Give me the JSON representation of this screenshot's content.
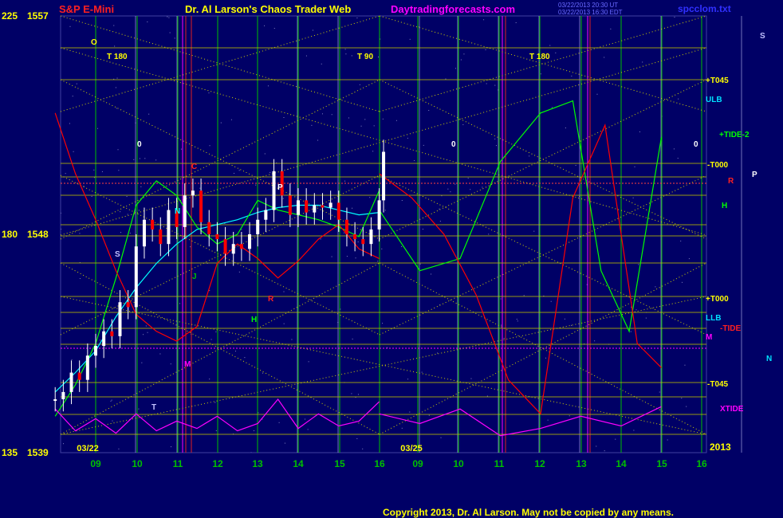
{
  "header": {
    "instrument": "S&P E-Mini",
    "title": "Dr. Al Larson's Chaos Trader Web",
    "site": "Daytradingforecasts.com",
    "timestamp_line1": "03/22/2013 20:30 UT",
    "timestamp_line2": "03/22/2013 16:30 EDT",
    "file": "spcclom.txt"
  },
  "footer": {
    "copyright": "Copyright 2013, Dr. Al Larson. May not be copied by any means.",
    "year": "2013"
  },
  "chart_data": {
    "type": "line",
    "title": "S&P E-Mini",
    "y_axis": {
      "range": [
        1539,
        1557
      ],
      "tick_labels": [
        {
          "angle": "225",
          "price": "1557"
        },
        {
          "angle": "180",
          "price": "1548"
        },
        {
          "angle": "135",
          "price": "1539"
        }
      ]
    },
    "x_axis": {
      "hour_labels": [
        "09",
        "10",
        "11",
        "12",
        "13",
        "14",
        "15",
        "16",
        "09",
        "10",
        "11",
        "12",
        "13",
        "14",
        "15",
        "16"
      ],
      "date_labels": [
        "03/22",
        "03/25"
      ]
    },
    "grid": true,
    "price_series": {
      "name": "",
      "x_hours": [
        8.0,
        8.2,
        8.4,
        8.6,
        8.8,
        9.0,
        9.2,
        9.4,
        9.6,
        9.8,
        10.0,
        10.2,
        10.4,
        10.6,
        10.8,
        11.0,
        11.2,
        11.4,
        11.6,
        11.8,
        12.0,
        12.2,
        12.4,
        12.6,
        12.8,
        13.0,
        13.2,
        13.4,
        13.6,
        13.8,
        14.0,
        14.2,
        14.4,
        14.6,
        14.8,
        15.0,
        15.2,
        15.4,
        15.6,
        15.8,
        16.0,
        16.1
      ],
      "prices": [
        1541.2,
        1541.5,
        1542.3,
        1542.0,
        1543.0,
        1543.4,
        1544.0,
        1543.8,
        1545.2,
        1545.0,
        1547.5,
        1548.6,
        1548.2,
        1547.6,
        1549.0,
        1548.3,
        1549.6,
        1549.8,
        1548.5,
        1548.0,
        1547.8,
        1547.2,
        1547.6,
        1547.4,
        1548.0,
        1548.6,
        1549.0,
        1550.6,
        1549.6,
        1548.8,
        1549.4,
        1548.9,
        1549.2,
        1549.1,
        1549.3,
        1548.6,
        1548.0,
        1547.8,
        1547.6,
        1548.2,
        1549.4,
        1551.4
      ]
    },
    "series": [
      {
        "name": "",
        "color": "#00FFFF",
        "hours": [
          8.0,
          8.5,
          9.0,
          9.5,
          10.0,
          10.5,
          11.0,
          11.5,
          12.0,
          12.5,
          13.0,
          13.5,
          14.0,
          14.5,
          15.0,
          15.5,
          16.0
        ],
        "values": [
          1541.5,
          1542.3,
          1543.2,
          1544.6,
          1545.8,
          1546.8,
          1547.6,
          1548.2,
          1548.4,
          1548.6,
          1548.9,
          1549.1,
          1549.2,
          1549.2,
          1549.0,
          1548.8,
          1548.9
        ]
      },
      {
        "name": "",
        "color": "#00FF00",
        "hours": [
          8.0,
          8.5,
          9.0,
          9.5,
          10.0,
          10.5,
          11.0,
          11.5,
          12.0,
          12.5,
          13.0,
          13.5,
          14.0,
          14.5,
          15.0,
          15.5,
          16.0
        ],
        "values": [
          1540.5,
          1541.8,
          1543.5,
          1546.2,
          1549.2,
          1550.2,
          1549.6,
          1548.3,
          1547.6,
          1548.0,
          1549.4,
          1549.0,
          1548.8,
          1548.6,
          1548.3,
          1547.9,
          1549.8
        ]
      },
      {
        "name": "",
        "color": "#FF0000",
        "hours": [
          8.0,
          8.5,
          9.0,
          9.5,
          10.0,
          10.5,
          11.0,
          11.5,
          12.0,
          12.5,
          13.0,
          13.5,
          14.0,
          14.5,
          15.0,
          15.5,
          16.0
        ],
        "values": [
          1553.0,
          1550.5,
          1548.6,
          1546.5,
          1544.7,
          1544.0,
          1543.6,
          1544.2,
          1546.8,
          1547.6,
          1547.0,
          1546.2,
          1546.9,
          1547.8,
          1548.4,
          1547.4,
          1547.0
        ]
      },
      {
        "name": "",
        "color": "#FF00FF",
        "hours": [
          8.0,
          8.5,
          9.0,
          9.5,
          10.0,
          10.5,
          11.0,
          11.5,
          12.0,
          12.5,
          13.0,
          13.5,
          14.0,
          14.5,
          15.0,
          15.5,
          16.0
        ],
        "values": [
          1540.8,
          1539.9,
          1540.4,
          1539.8,
          1540.6,
          1539.9,
          1540.3,
          1540.0,
          1540.5,
          1539.9,
          1540.2,
          1541.2,
          1540.0,
          1540.6,
          1540.1,
          1540.3,
          1541.1
        ]
      }
    ],
    "forecast_series": [
      {
        "name": "",
        "color": "#00FF00",
        "hours": [
          16.0,
          17.0,
          18.0,
          19.0,
          20.0,
          20.8,
          21.5,
          22.2,
          23.0
        ],
        "values": [
          1549.0,
          1546.5,
          1547.0,
          1551.0,
          1553.0,
          1553.5,
          1546.5,
          1544.0,
          1552.0
        ]
      },
      {
        "name": "",
        "color": "#FF0000",
        "hours": [
          16.0,
          16.8,
          17.6,
          18.4,
          19.2,
          20.0,
          20.8,
          21.6,
          22.4,
          23.0
        ],
        "values": [
          1550.5,
          1549.5,
          1548.0,
          1545.5,
          1542.0,
          1540.6,
          1549.5,
          1552.5,
          1543.5,
          1542.5
        ]
      },
      {
        "name": "",
        "color": "#FF00FF",
        "hours": [
          16.0,
          17.0,
          18.0,
          19.0,
          20.0,
          21.0,
          22.0,
          23.0
        ],
        "values": [
          1540.6,
          1540.2,
          1540.8,
          1539.7,
          1540.0,
          1540.5,
          1540.1,
          1540.9
        ]
      }
    ],
    "annotations": {
      "T_markers": [
        "T 180",
        "T 90",
        "T 180"
      ],
      "right_labels": [
        "+T045",
        "ULB",
        "+TIDE-2",
        "-T000",
        "+T000",
        "LLB",
        "-TIDE",
        "-T045",
        "XTIDE",
        "M",
        "R",
        "H",
        "P",
        "S",
        "N",
        "0",
        "0",
        "0"
      ],
      "planet_letters": [
        "S",
        "P",
        "R",
        "H",
        "N",
        "M",
        "J",
        "C",
        "O",
        "T"
      ]
    }
  }
}
